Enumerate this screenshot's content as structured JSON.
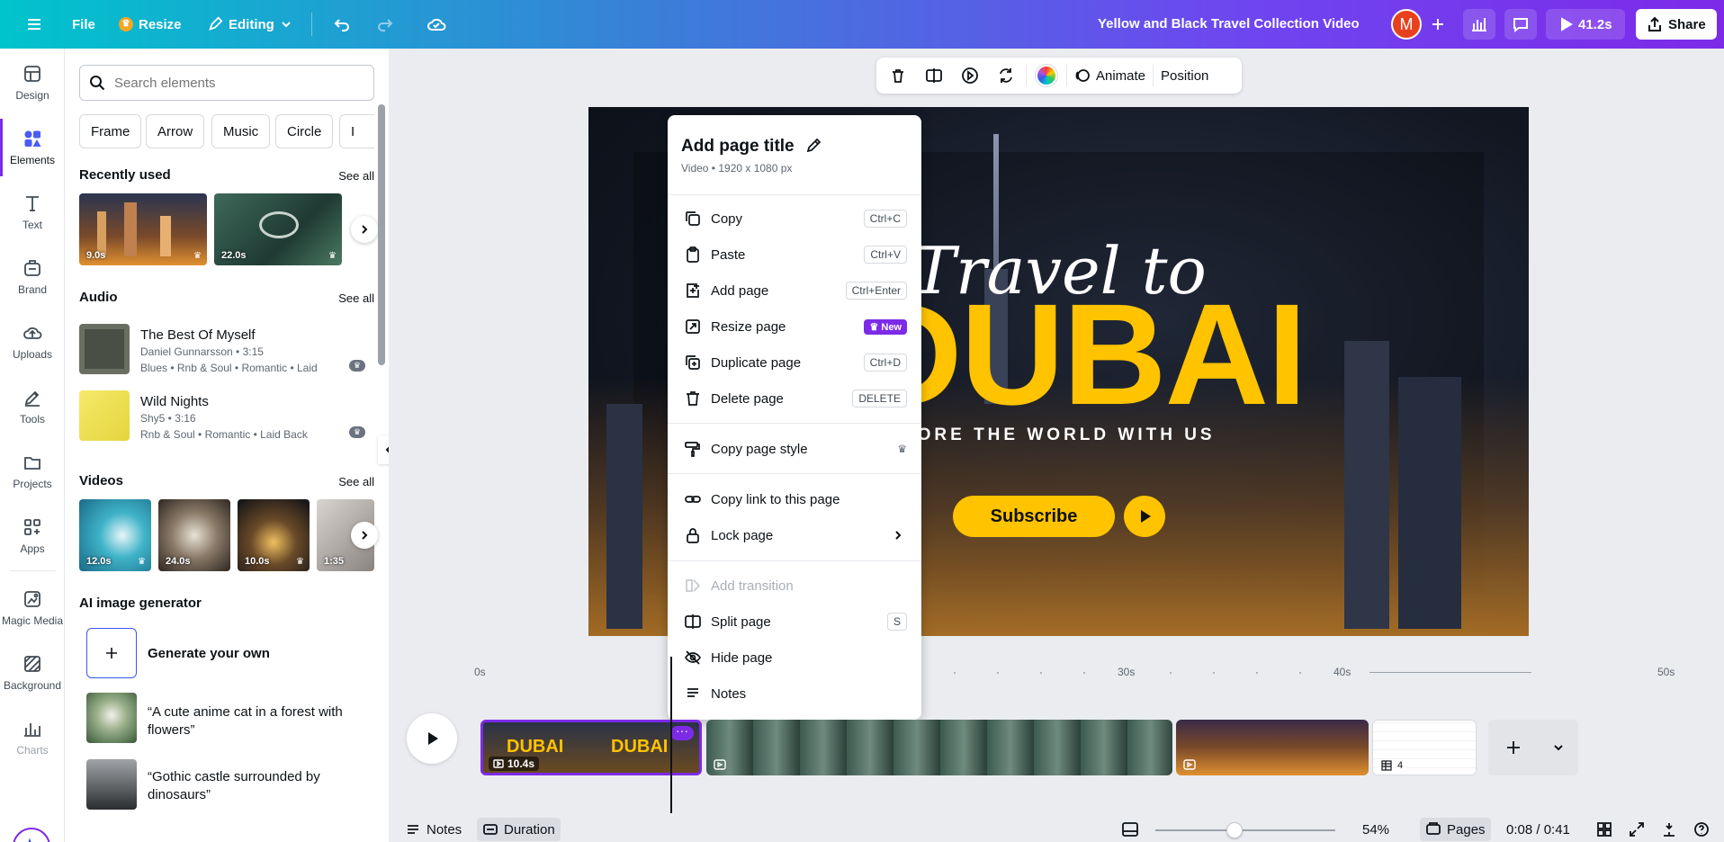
{
  "topbar": {
    "file_label": "File",
    "resize_label": "Resize",
    "editing_label": "Editing",
    "doc_title": "Yellow and Black Travel Collection Video",
    "avatar_initial": "M",
    "present_label": "41.2s",
    "share_label": "Share"
  },
  "rail": {
    "items": [
      {
        "label": "Design",
        "icon": "design-icon"
      },
      {
        "label": "Elements",
        "icon": "elements-icon"
      },
      {
        "label": "Text",
        "icon": "text-icon"
      },
      {
        "label": "Brand",
        "icon": "brand-icon"
      },
      {
        "label": "Uploads",
        "icon": "uploads-icon"
      },
      {
        "label": "Tools",
        "icon": "tools-icon"
      },
      {
        "label": "Projects",
        "icon": "projects-icon"
      },
      {
        "label": "Apps",
        "icon": "apps-icon"
      },
      {
        "label": "Magic Media",
        "icon": "magic-media-icon"
      },
      {
        "label": "Background",
        "icon": "background-icon"
      },
      {
        "label": "Charts",
        "icon": "charts-icon"
      }
    ]
  },
  "panel": {
    "search_placeholder": "Search elements",
    "chips": [
      "Frame",
      "Arrow",
      "Music",
      "Circle",
      "I"
    ],
    "recently_used": {
      "title": "Recently used",
      "see_all": "See all",
      "items": [
        "9.0s",
        "22.0s"
      ]
    },
    "audio": {
      "title": "Audio",
      "see_all": "See all",
      "tracks": [
        {
          "title": "The Best Of Myself",
          "artist": "Daniel Gunnarsson • 3:15",
          "tags": "Blues • Rnb & Soul • Romantic • Laid"
        },
        {
          "title": "Wild Nights",
          "artist": "Shy5 • 3:16",
          "tags": "Rnb & Soul • Romantic • Laid Back"
        }
      ]
    },
    "videos": {
      "title": "Videos",
      "see_all": "See all",
      "items": [
        "12.0s",
        "24.0s",
        "10.0s",
        "1:35"
      ]
    },
    "ai": {
      "title": "AI image generator",
      "generate_label": "Generate your own",
      "prompts": [
        "“A cute anime cat in a forest with flowers”",
        "“Gothic castle surrounded by dinosaurs”"
      ]
    }
  },
  "floatbar": {
    "animate_label": "Animate",
    "position_label": "Position"
  },
  "design": {
    "script_text": "Travel to",
    "main_text": "DUBAI",
    "tagline": "EXPLORE THE WORLD WITH US",
    "subscribe_label": "Subscribe"
  },
  "menu": {
    "title": "Add page title",
    "subtitle": "Video • 1920 x 1080 px",
    "items": [
      {
        "label": "Copy",
        "shortcut": "Ctrl+C"
      },
      {
        "label": "Paste",
        "shortcut": "Ctrl+V"
      },
      {
        "label": "Add page",
        "shortcut": "Ctrl+Enter"
      },
      {
        "label": "Resize page",
        "badge": "New"
      },
      {
        "label": "Duplicate page",
        "shortcut": "Ctrl+D"
      },
      {
        "label": "Delete page",
        "shortcut": "DELETE"
      },
      {
        "label": "Copy page style"
      },
      {
        "label": "Copy link to this page"
      },
      {
        "label": "Lock page"
      },
      {
        "label": "Add transition"
      },
      {
        "label": "Split page",
        "shortcut": "S"
      },
      {
        "label": "Hide page"
      },
      {
        "label": "Notes"
      }
    ]
  },
  "timeline": {
    "ticks": [
      "0s",
      "30s",
      "40s",
      "50s"
    ],
    "clip1_duration": "10.4s",
    "clip4_count": "4"
  },
  "bottombar": {
    "notes_label": "Notes",
    "duration_label": "Duration",
    "zoom_label": "54%",
    "zoom_value": 0.44,
    "pages_label": "Pages",
    "time_label": "0:08 / 0:41"
  },
  "colors": {
    "accent": "#7d2ae8",
    "brand_teal": "#00c4cc",
    "dubai_yellow": "#ffc300"
  }
}
